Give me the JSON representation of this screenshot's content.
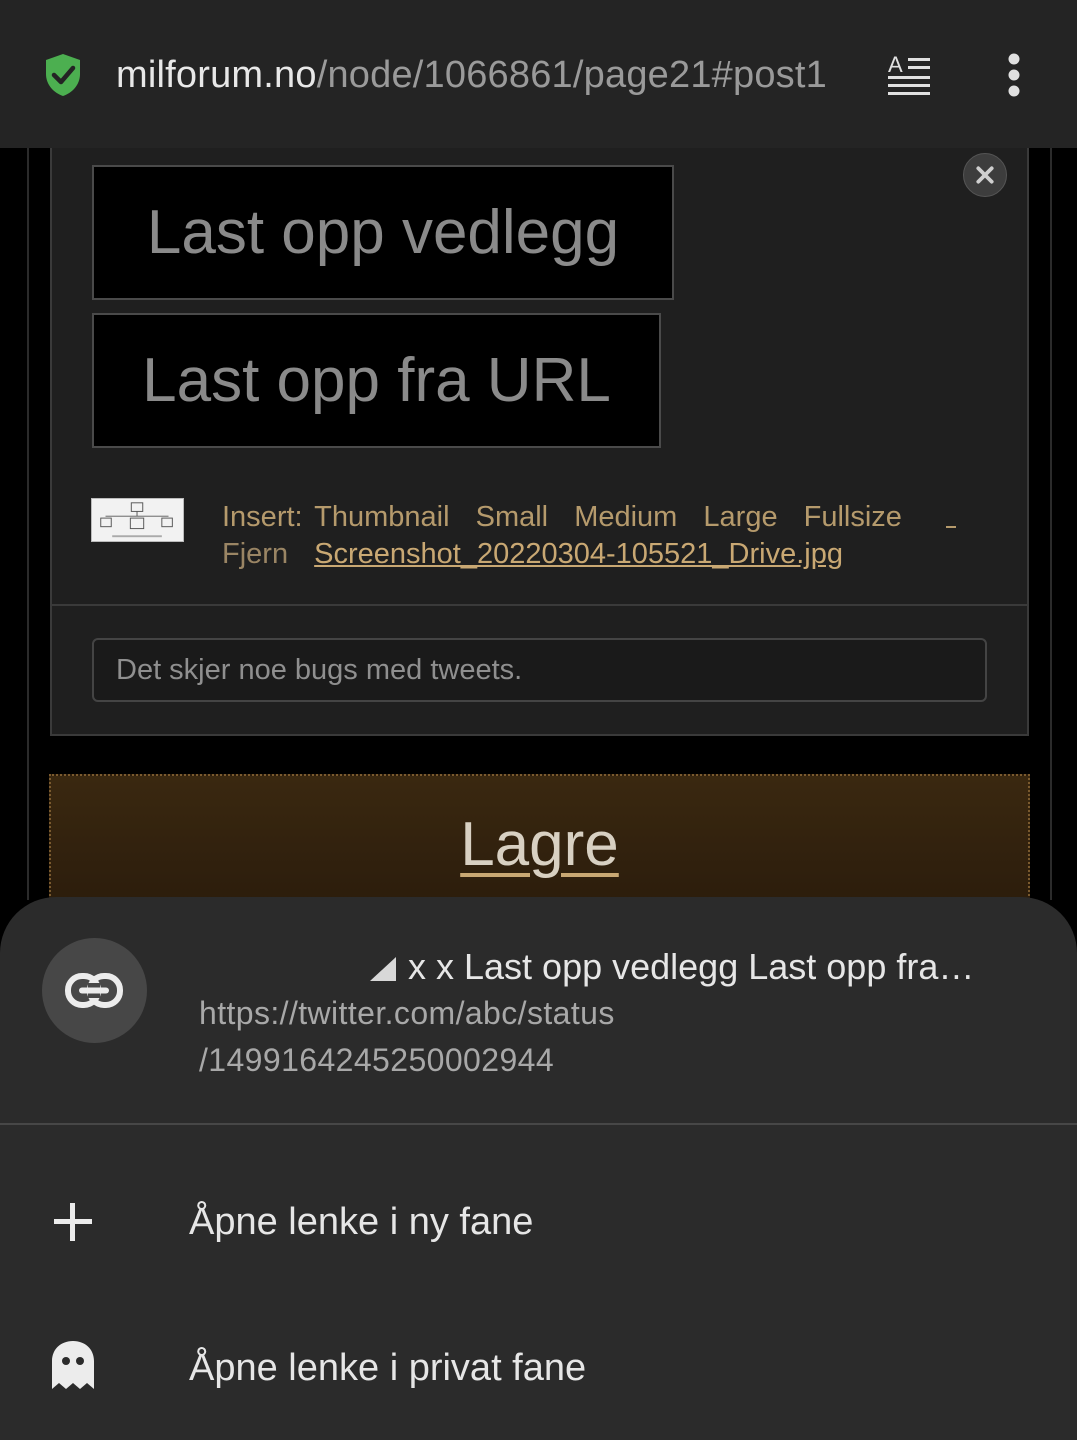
{
  "browser": {
    "url_host": "milforum.no",
    "url_path": "/node/1066861/page21#post1",
    "icons": [
      "shield-check-icon",
      "reader-mode-icon",
      "more-vert-icon"
    ],
    "accent": "#4caf50"
  },
  "editor": {
    "upload_attachment_label": "Last opp vedlegg",
    "upload_from_url_label": "Last opp fra URL",
    "attachment": {
      "insert_label": "Insert:",
      "sizes": [
        "Thumbnail",
        "Small",
        "Medium",
        "Large",
        "Fullsize"
      ],
      "remove_label": "Fjern",
      "filename": "Screenshot_20220304-105521_Drive.jpg"
    },
    "message_value": "Det skjer noe bugs med tweets.",
    "save_label": "Lagre"
  },
  "context_menu": {
    "title": "x x Last opp vedlegg  Last opp fra…",
    "link_url_line1": "https://twitter.com/abc/status",
    "link_url_line2": "/1499164245250002944",
    "items": [
      {
        "label": "Åpne lenke i ny fane",
        "icon": "plus-icon"
      },
      {
        "label": "Åpne lenke i privat fane",
        "icon": "ghost-icon"
      }
    ]
  }
}
